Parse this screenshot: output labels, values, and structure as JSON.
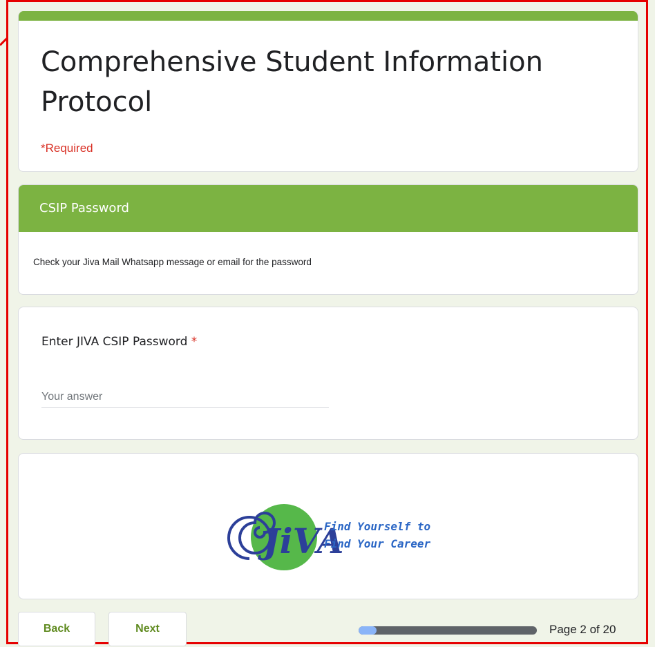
{
  "form": {
    "title": "Comprehensive Student Information Protocol",
    "required_note": "*Required",
    "accent_color": "#7cb342"
  },
  "section": {
    "header": "CSIP Password",
    "description": "Check your Jiva Mail Whatsapp message or email for the password"
  },
  "question": {
    "label": "Enter JIVA CSIP Password",
    "required_marker": "*",
    "value": "",
    "placeholder": "Your answer"
  },
  "logo": {
    "brand": "JIVA",
    "tagline_line1": "Find Yourself to",
    "tagline_line2": "Find Your Career"
  },
  "navigation": {
    "back_label": "Back",
    "next_label": "Next",
    "page_label": "Page 2 of 20",
    "progress_fraction": 0.1
  }
}
